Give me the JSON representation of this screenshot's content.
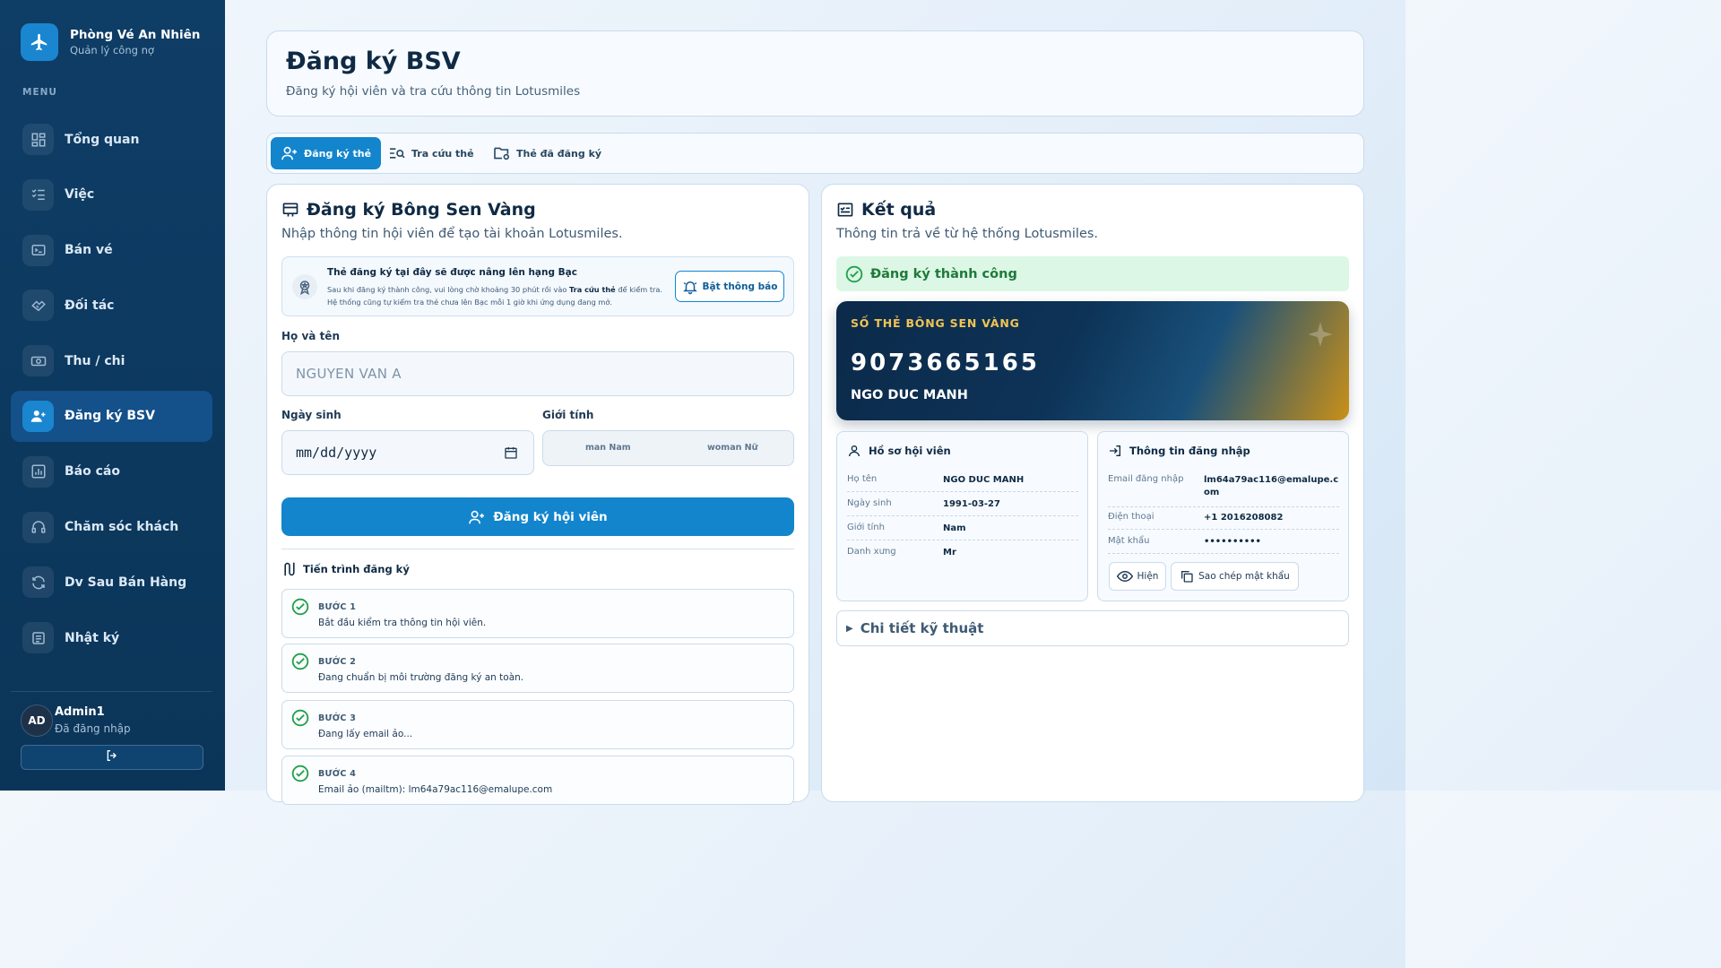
{
  "brand": {
    "name": "Phòng Vé An Nhiên",
    "subtitle": "Quản lý công nợ"
  },
  "menu_label": "MENU",
  "nav": [
    {
      "label": "Tổng quan",
      "icon": "dashboard-icon"
    },
    {
      "label": "Việc",
      "icon": "tasks-icon"
    },
    {
      "label": "Bán vé",
      "icon": "ticket-icon"
    },
    {
      "label": "Đối tác",
      "icon": "handshake-icon"
    },
    {
      "label": "Thu / chi",
      "icon": "money-icon"
    },
    {
      "label": "Đăng ký BSV",
      "icon": "user-plus-icon",
      "active": true
    },
    {
      "label": "Báo cáo",
      "icon": "report-icon"
    },
    {
      "label": "Chăm sóc khách",
      "icon": "headset-icon"
    },
    {
      "label": "Dv Sau Bán Hàng",
      "icon": "refresh-icon"
    },
    {
      "label": "Nhật ký",
      "icon": "log-icon"
    }
  ],
  "user": {
    "initials": "AD",
    "name": "Admin1",
    "status": "Đã đăng nhập"
  },
  "header": {
    "title": "Đăng ký BSV",
    "subtitle": "Đăng ký hội viên và tra cứu thông tin Lotusmiles"
  },
  "tabs": [
    {
      "label": "Đăng ký thẻ",
      "active": true
    },
    {
      "label": "Tra cứu thẻ"
    },
    {
      "label": "Thẻ đã đăng ký"
    }
  ],
  "form": {
    "title": "Đăng ký Bông Sen Vàng",
    "subtitle": "Nhập thông tin hội viên để tạo tài khoản Lotusmiles.",
    "notice": {
      "title": "Thẻ đăng ký tại đây sẽ được nâng lên hạng Bạc",
      "text_before": "Sau khi đăng ký thành công, vui lòng chờ khoảng 30 phút rồi vào ",
      "text_bold": "Tra cứu thẻ",
      "text_after": " để kiểm tra. Hệ thống cũng tự kiểm tra thẻ chưa lên Bạc mỗi 1 giờ khi ứng dụng đang mở.",
      "button": "Bật thông báo"
    },
    "name_label": "Họ và tên",
    "name_placeholder": "NGUYEN VAN A",
    "dob_label": "Ngày sinh",
    "dob_placeholder": "mm/dd/yyyy",
    "gender_label": "Giới tính",
    "gender_options": [
      "man Nam",
      "woman Nữ"
    ],
    "submit": "Đăng ký hội viên",
    "progress_title": "Tiến trình đăng ký",
    "steps": [
      {
        "name": "BƯỚC 1",
        "text": "Bắt đầu kiểm tra thông tin hội viên."
      },
      {
        "name": "BƯỚC 2",
        "text": "Đang chuẩn bị môi trường đăng ký an toàn."
      },
      {
        "name": "BƯỚC 3",
        "text": "Đang lấy email ảo..."
      },
      {
        "name": "BƯỚC 4",
        "text": "Email ảo (mailtm): lm64a79ac116@emalupe.com"
      }
    ]
  },
  "result": {
    "title": "Kết quả",
    "subtitle": "Thông tin trả về từ hệ thống Lotusmiles.",
    "success": "Đăng ký thành công",
    "card": {
      "label": "SỐ THẺ BÔNG SEN VÀNG",
      "number": "9073665165",
      "holder": "NGO DUC MANH"
    },
    "profile": {
      "title": "Hồ sơ hội viên",
      "rows": [
        {
          "key": "Họ tên",
          "value": "NGO DUC MANH"
        },
        {
          "key": "Ngày sinh",
          "value": "1991-03-27"
        },
        {
          "key": "Giới tính",
          "value": "Nam"
        },
        {
          "key": "Danh xưng",
          "value": "Mr"
        }
      ]
    },
    "login": {
      "title": "Thông tin đăng nhập",
      "rows": [
        {
          "key": "Email đăng nhập",
          "value": "lm64a79ac116@emalupe.com"
        },
        {
          "key": "Điện thoại",
          "value": "+1 2016208082"
        },
        {
          "key": "Mật khẩu",
          "value": "••••••••••"
        }
      ],
      "show_btn": "Hiện",
      "copy_btn": "Sao chép mật khẩu"
    },
    "details": "Chi tiết kỹ thuật"
  },
  "colors": {
    "sidebar": "#0e3d66",
    "accent": "#1285cd",
    "success_bg": "#dcf7e5",
    "success_text": "#1f7a3a",
    "card_gold": "#f1c453"
  }
}
